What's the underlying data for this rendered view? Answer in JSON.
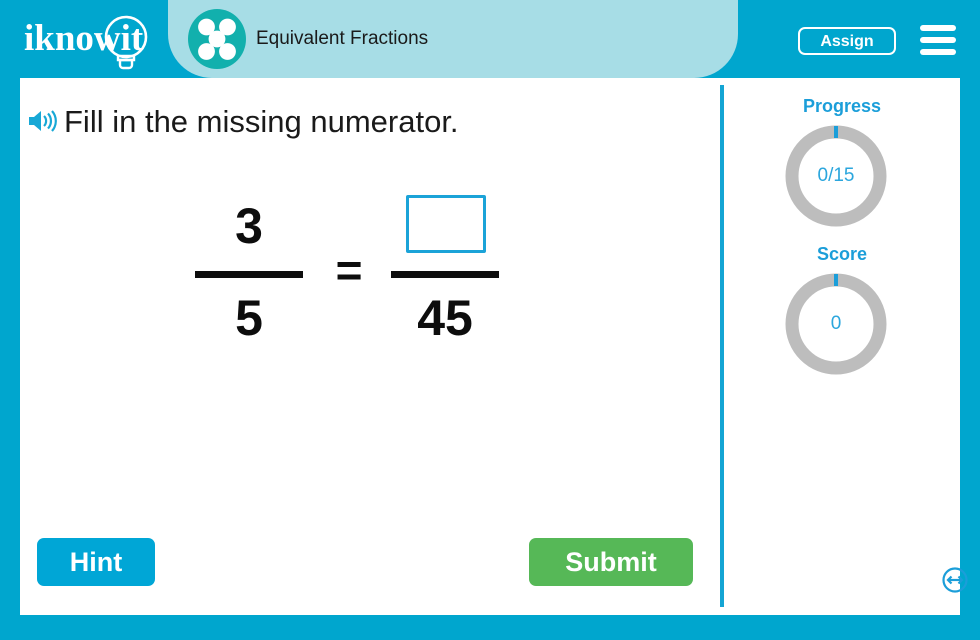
{
  "header": {
    "logo_text": "iknowit",
    "logo_icon": "lightbulb-icon",
    "subject_icon": "five-dots-circle-icon",
    "title": "Equivalent Fractions",
    "assign_label": "Assign",
    "menu_icon": "hamburger-menu-icon",
    "background_color": "#00a6ce",
    "title_pill_color": "#a7dde6"
  },
  "question": {
    "audio_icon": "speaker-icon",
    "prompt": "Fill in the missing numerator."
  },
  "equation": {
    "left_fraction": {
      "numerator": "3",
      "denominator": "5"
    },
    "operator": "=",
    "right_fraction": {
      "numerator_value": "",
      "numerator_placeholder": "",
      "denominator": "45"
    },
    "input_border_color": "#1ba3d8"
  },
  "actions": {
    "hint_label": "Hint",
    "hint_color": "#00a6d6",
    "submit_label": "Submit",
    "submit_color": "#56b857"
  },
  "side_panel": {
    "progress": {
      "label": "Progress",
      "value": "0/15",
      "completed": 0,
      "total": 15,
      "ring_color": "#bdbdbd",
      "marker_color": "#1b9ed9"
    },
    "score": {
      "label": "Score",
      "value": "0",
      "points": 0,
      "ring_color": "#bdbdbd",
      "marker_color": "#1b9ed9"
    },
    "fullscreen_icon": "resize-horizontal-icon",
    "fullscreen_color": "#1b9ed9"
  }
}
